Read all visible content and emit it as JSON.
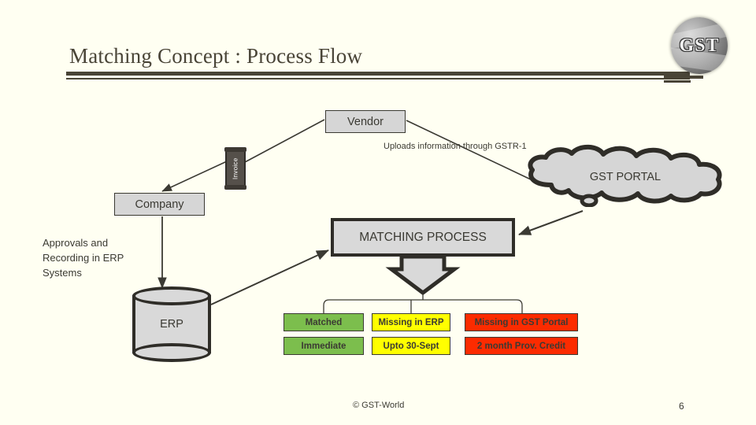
{
  "slide": {
    "title": "Matching Concept : Process Flow",
    "background_color": "#fffff2",
    "ink_color": "#3b3a33"
  },
  "logo": {
    "text": "GST",
    "name": "gst-globe-logo"
  },
  "diagram": {
    "vendor_label": "Vendor",
    "invoice_label": "Invoice",
    "company_label": "Company",
    "erp_label": "ERP",
    "portal_label": "GST PORTAL",
    "matching_label": "MATCHING PROCESS",
    "upload_edge_label": "Uploads information through GSTR-1",
    "left_note": "Approvals and Recording in ERP Systems"
  },
  "outcomes": [
    {
      "status": "Matched",
      "timing": "Immediate",
      "color": "#7cbe4d",
      "name": "matched"
    },
    {
      "status": "Missing in ERP",
      "timing": "Upto 30-Sept",
      "color": "#ffff00",
      "name": "missing-in-erp"
    },
    {
      "status": "Missing in GST Portal",
      "timing": "2 month Prov. Credit",
      "color": "#fc2b00",
      "name": "missing-in-gst-portal"
    }
  ],
  "footer": {
    "copyright": "© GST-World",
    "page_number": "6"
  }
}
